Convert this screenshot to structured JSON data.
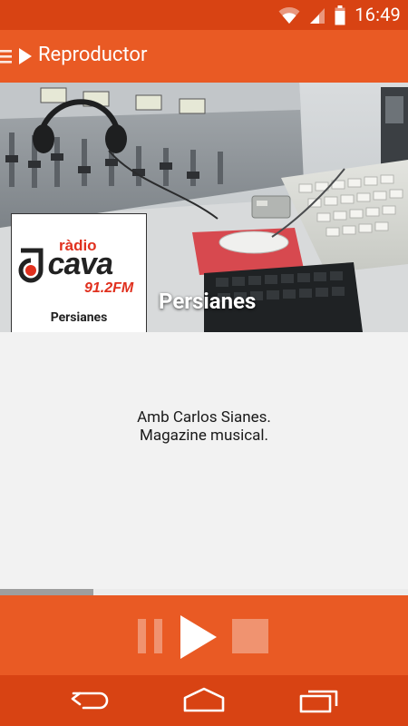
{
  "status_bar": {
    "time": "16:49",
    "icons": [
      "wifi-icon",
      "signal-icon",
      "battery-icon"
    ]
  },
  "app_bar": {
    "title": "Reproductor",
    "icons": [
      "menu-icon",
      "play-small-icon"
    ]
  },
  "banner": {
    "image": "radio-studio-photo",
    "station_logo": {
      "line1": "ràdio",
      "line2": "cava",
      "frequency": "91.2FM",
      "caption": "Persianes"
    },
    "program_title": "Persianes"
  },
  "description": {
    "line1": "Amb Carlos Sianes.",
    "line2": "Magazine musical."
  },
  "progress": {
    "fraction": 0.228
  },
  "player_controls": {
    "buttons": [
      "pause-button",
      "play-button",
      "stop-button"
    ],
    "pause_enabled": false,
    "stop_enabled": false
  },
  "nav_bar": {
    "buttons": [
      "back-button",
      "home-button",
      "recents-button"
    ]
  },
  "colors": {
    "accent": "#e95a24",
    "status_bar": "#d84313",
    "logo_red": "#e0301e",
    "logo_dark": "#222222"
  }
}
